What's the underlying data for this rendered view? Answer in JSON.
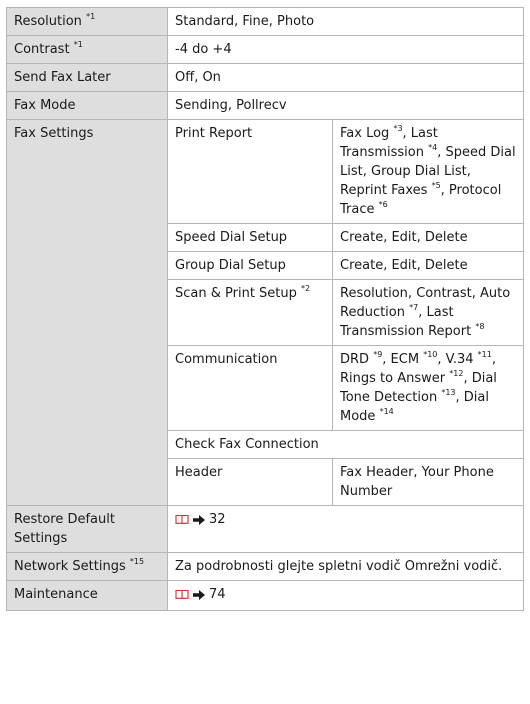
{
  "rows": {
    "resolution": {
      "label": "Resolution",
      "sup": "*1",
      "value": "Standard, Fine, Photo"
    },
    "contrast": {
      "label": "Contrast",
      "sup": "*1",
      "value": "-4 do +4"
    },
    "send_fax_later": {
      "label": "Send Fax Later",
      "value": "Off, On"
    },
    "fax_mode": {
      "label": "Fax Mode",
      "value": "Sending, Pollrecv"
    },
    "fax_settings": {
      "label": "Fax Settings",
      "print_report": {
        "label": "Print Report",
        "v1": "Fax Log ",
        "s1": "*3",
        "v2": ", Last Transmission ",
        "s2": "*4",
        "v3": ", Speed Dial List, Group Dial List, Reprint Faxes ",
        "s3": "*5",
        "v4": ", Protocol Trace ",
        "s4": "*6"
      },
      "speed_dial_setup": {
        "label": "Speed Dial Setup",
        "value": "Create, Edit, Delete"
      },
      "group_dial_setup": {
        "label": "Group Dial Setup",
        "value": "Create, Edit, Delete"
      },
      "scan_print_setup": {
        "label": "Scan & Print Setup ",
        "sup": "*2",
        "v1": "Resolution, Contrast, Auto Reduction ",
        "s1": "*7",
        "v2": ", Last Transmission Report ",
        "s2": "*8"
      },
      "communication": {
        "label": "Communication",
        "v1": "DRD ",
        "s1": "*9",
        "v2": ", ECM ",
        "s2": "*10",
        "v3": ", V.34 ",
        "s3": "*11",
        "v4": ", Rings to Answer ",
        "s4": "*12",
        "v5": ", Dial Tone Detection ",
        "s5": "*13",
        "v6": ", Dial Mode ",
        "s6": "*14"
      },
      "check_fax_connection": {
        "label": "Check Fax Connection"
      },
      "header": {
        "label": "Header",
        "value": "Fax Header, Your Phone Number"
      }
    },
    "restore_default": {
      "label": "Restore Default Settings",
      "page": "32",
      "icon": "book-icon",
      "arrow": "arrow-right-icon"
    },
    "network_settings": {
      "label": "Network Settings ",
      "sup": "*15",
      "value": "Za podrobnosti glejte spletni vodič Omrežni vodič."
    },
    "maintenance": {
      "label": "Maintenance",
      "page": "74",
      "icon": "book-icon",
      "arrow": "arrow-right-icon"
    }
  },
  "colors": {
    "label_bg": "#dedede",
    "border": "#b5b5b5",
    "icon_red": "#e0262e"
  }
}
